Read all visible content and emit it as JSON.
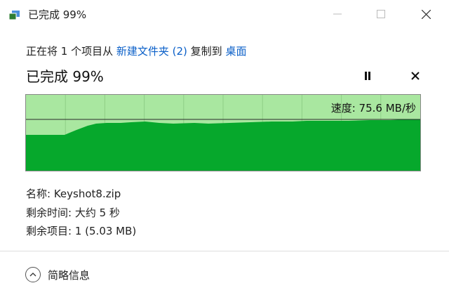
{
  "window": {
    "title": "已完成 99%",
    "minimize_label": "—",
    "maximize_label": "☐",
    "close_label": "✕"
  },
  "transfer": {
    "prefix": "正在将 1 个项目从 ",
    "source": "新建文件夹 (2)",
    "middle": " 复制到 ",
    "destination": "桌面"
  },
  "progress": {
    "headline": "已完成 99%",
    "percent": 99,
    "speed_label": "速度: 75.6 MB/秒"
  },
  "details": {
    "name_label": "名称:",
    "name_value": "Keyshot8.zip",
    "time_label": "剩余时间:",
    "time_value": "大约 5 秒",
    "items_label": "剩余项目:",
    "items_value": "1 (5.03 MB)"
  },
  "footer": {
    "toggle_label": "简略信息"
  },
  "colors": {
    "graph_fill": "#06a82c",
    "graph_background": "#a9e7a0",
    "graph_grid": "#8fcf86",
    "link": "#0a5fc8"
  }
}
